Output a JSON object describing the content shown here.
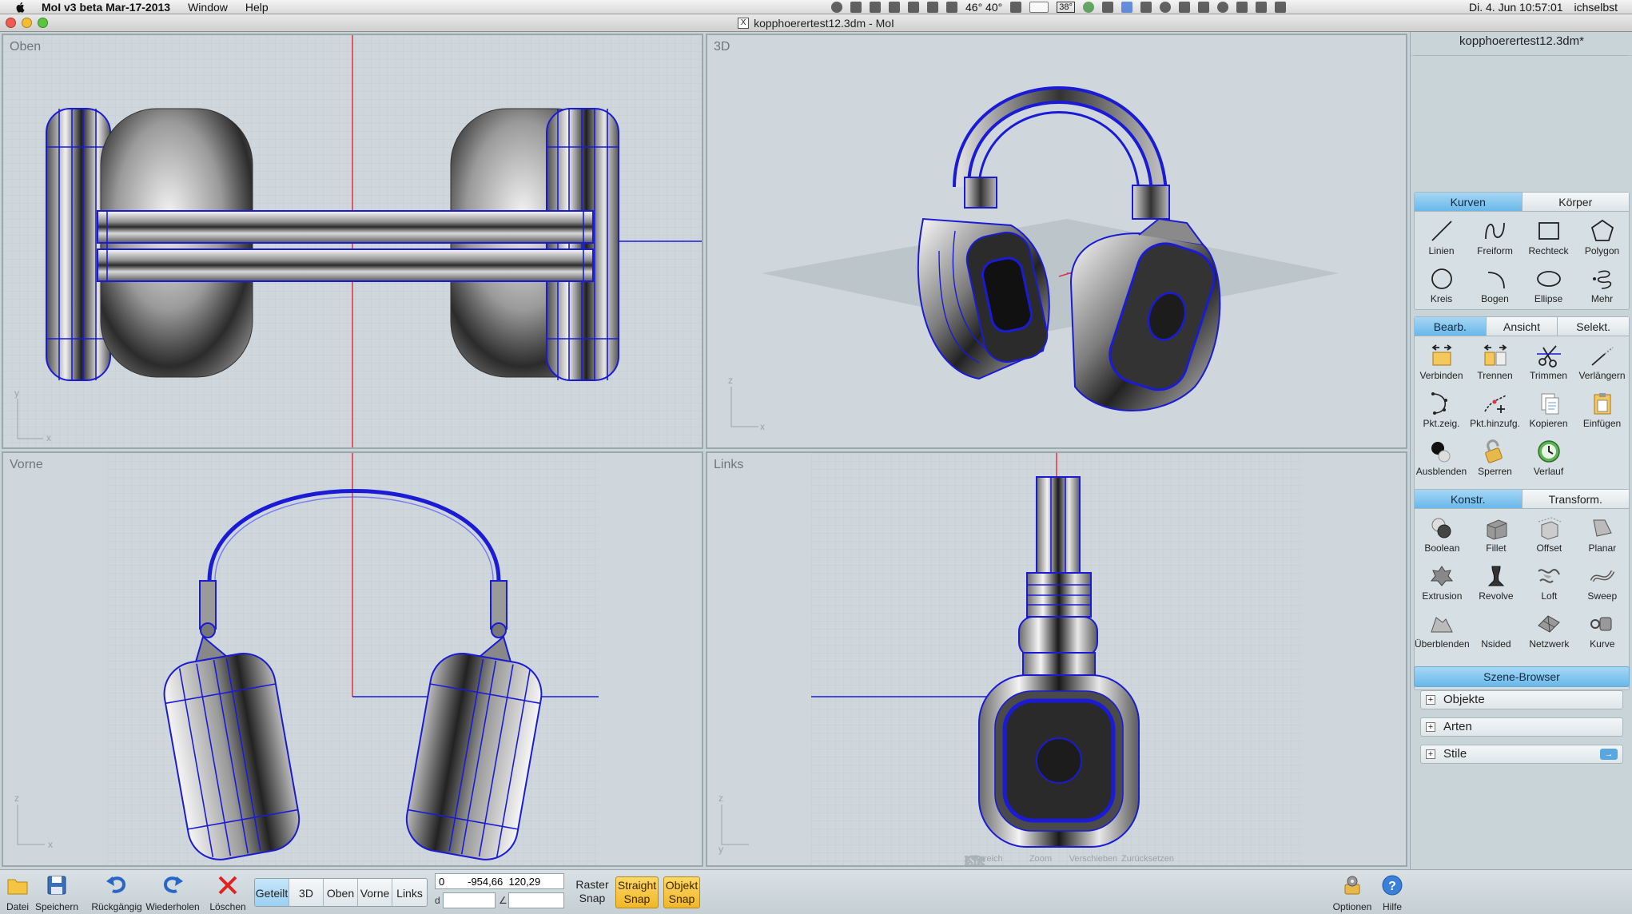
{
  "menubar": {
    "app_name": "MoI v3 beta Mar-17-2013",
    "menus": [
      "Window",
      "Help"
    ],
    "temperature": "46° 40°",
    "badge": "38°",
    "datetime": "Di. 4. Jun  10:57:01",
    "user": "ichselbst"
  },
  "window": {
    "title": "kopphoerertest12.3dm - MoI",
    "traffic_colors": [
      "#f25a52",
      "#f5bc33",
      "#5ac541"
    ]
  },
  "viewports": {
    "top": {
      "label": "Oben",
      "axes": [
        "y",
        "x"
      ]
    },
    "3d": {
      "label": "3D",
      "axes": [
        "z",
        "x"
      ]
    },
    "front": {
      "label": "Vorne",
      "axes": [
        "z",
        "x"
      ]
    },
    "left": {
      "label": "Links",
      "axes": [
        "z",
        "y"
      ]
    }
  },
  "view_nav": {
    "region": "Bereich",
    "zoom": "Zoom",
    "pan": "Verschieben",
    "reset": "Zurücksetzen"
  },
  "panel": {
    "filename": "kopphoerertest12.3dm*",
    "curves_tabs": [
      "Kurven",
      "Körper"
    ],
    "curves_tools": [
      "Linien",
      "Freiform",
      "Rechteck",
      "Polygon",
      "Kreis",
      "Bogen",
      "Ellipse",
      "Mehr"
    ],
    "edit_tabs": [
      "Bearb.",
      "Ansicht",
      "Selekt."
    ],
    "edit_tools": [
      "Verbinden",
      "Trennen",
      "Trimmen",
      "Verlängern",
      "Pkt.zeig.",
      "Pkt.hinzufg.",
      "Kopieren",
      "Einfügen",
      "Ausblenden",
      "Sperren",
      "Verlauf"
    ],
    "construct_tabs": [
      "Konstr.",
      "Transform."
    ],
    "construct_tools": [
      "Boolean",
      "Fillet",
      "Offset",
      "Planar",
      "Extrusion",
      "Revolve",
      "Loft",
      "Sweep",
      "Überblenden",
      "Nsided",
      "Netzwerk",
      "Kurve"
    ],
    "scene_browser": "Szene-Browser",
    "scene_items": [
      "Objekte",
      "Arten",
      "Stile"
    ]
  },
  "bottombar": {
    "file": "Datei",
    "save": "Speichern",
    "undo": "Rückgängig",
    "redo": "Wiederholen",
    "delete": "Löschen",
    "views": [
      "Geteilt",
      "3D",
      "Oben",
      "Vorne",
      "Links"
    ],
    "coord_value": "0        -954,66  120,29",
    "distance_label": "d",
    "angle_label": "∠",
    "grid_snap": "Raster Snap",
    "straight_snap": "Straight Snap",
    "object_snap": "Objekt Snap",
    "options": "Optionen",
    "help": "Hilfe"
  },
  "colors": {
    "wire": "#1b1bd6",
    "axis_red": "#e0304a",
    "accent_blue": "#69b8ea",
    "snap_yellow": "#f1b728"
  }
}
